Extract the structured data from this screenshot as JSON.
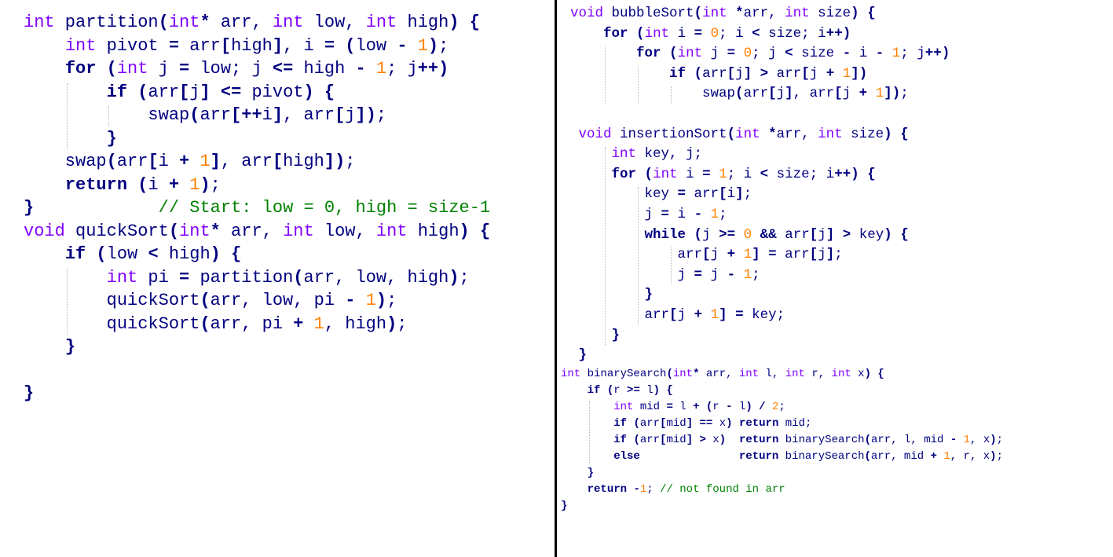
{
  "snippets": [
    {
      "name": "partition-quicksort",
      "lines": [
        "int partition(int* arr, int low, int high) {",
        "    int pivot = arr[high], i = (low - 1);",
        "    for (int j = low; j <= high - 1; j++)",
        "        if (arr[j] <= pivot) {",
        "            swap(arr[++i], arr[j]);",
        "        }",
        "    swap(arr[i + 1], arr[high]);",
        "    return (i + 1);",
        "}            // Start: low = 0, high = size-1",
        "void quickSort(int* arr, int low, int high) {",
        "    if (low < high) {",
        "        int pi = partition(arr, low, high);",
        "        quickSort(arr, low, pi - 1);",
        "        quickSort(arr, pi + 1, high);",
        "    }",
        "",
        "}"
      ]
    },
    {
      "name": "bubble-insertion",
      "lines": [
        "void bubbleSort(int *arr, int size) {",
        "    for (int i = 0; i < size; i++)",
        "        for (int j = 0; j < size - i - 1; j++)",
        "            if (arr[j] > arr[j + 1])",
        "                swap(arr[j], arr[j + 1]);",
        "",
        " void insertionSort(int *arr, int size) {",
        "     int key, j;",
        "     for (int i = 1; i < size; i++) {",
        "         key = arr[i];",
        "         j = i - 1;",
        "         while (j >= 0 && arr[j] > key) {",
        "             arr[j + 1] = arr[j];",
        "             j = j - 1;",
        "         }",
        "         arr[j + 1] = key;",
        "     }",
        " }"
      ]
    },
    {
      "name": "binary-search",
      "lines": [
        "int binarySearch(int* arr, int l, int r, int x) {",
        "    if (r >= l) {",
        "        int mid = l + (r - l) / 2;",
        "        if (arr[mid] == x) return mid;",
        "        if (arr[mid] > x)  return binarySearch(arr, l, mid - 1, x);",
        "        else               return binarySearch(arr, mid + 1, r, x);",
        "    }",
        "    return -1; // not found in arr",
        "}"
      ]
    }
  ]
}
